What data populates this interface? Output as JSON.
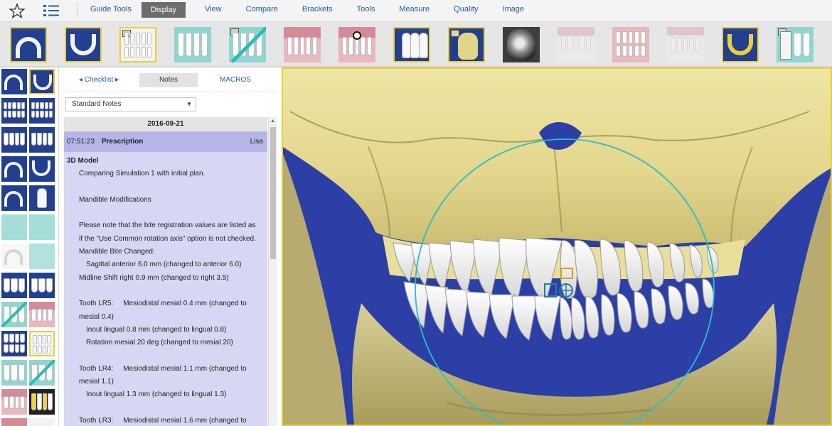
{
  "menu": {
    "items": [
      "Guide Tools",
      "Display",
      "View",
      "Compare",
      "Brackets",
      "Tools",
      "Measure",
      "Quality",
      "Image"
    ],
    "active": "Display"
  },
  "icons": {
    "favorites": "star-icon",
    "checklist": "checklist-icon"
  },
  "colors": {
    "menu_link": "#1f5a99",
    "active_tab": "#6d6d6d",
    "selection_border": "#e8d03a",
    "notes_background": "#d7d7f3",
    "prescription_header": "#b5b5e8",
    "viewport_background": "#2b3fa6",
    "bone": "#e9df9a",
    "guide_circle": "#2bbdc9"
  },
  "notes": {
    "tabs": {
      "checklist": "◂ Checklist ▸",
      "notes": "Notes",
      "macros": "MACROS"
    },
    "selector": "Standard Notes",
    "date": "2016-09-21",
    "entry": {
      "time": "07:51:23",
      "title": "Prescription",
      "user": "Lisa"
    },
    "lines": [
      "3D Model",
      "Comparing Simulation 1 with initial plan.",
      "",
      "Mandible Modifications",
      "",
      "Please note that the bite registration values are listed as",
      "if the \"Use Common rotation axis\" option is not checked.",
      "Mandible Bite Changed:",
      "Sagittal anterior 6.0 mm (changed to anterior 6.0)",
      "Midline Shift right 0.9 mm (changed to right 3.5)",
      "",
      "Tooth LR5:     Mesiodistal mesial 0.4 mm (changed to",
      "mesial 0.4)",
      "Inout lingual 0.8 mm (changed to lingual 0.8)",
      "Rotation mesial 20 deg (changed to mesial 20)",
      "",
      "Tooth LR4:     Mesiodistal mesial 1.1 mm (changed to",
      "mesial 1.1)",
      "Inout lingual 1.3 mm (changed to lingual 1.3)",
      "",
      "Tooth LR3:     Mesiodistal mesial 1.6 mm (changed to"
    ]
  }
}
